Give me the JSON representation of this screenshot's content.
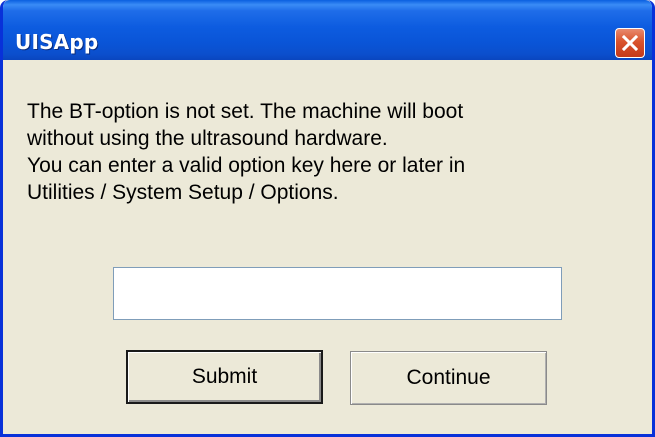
{
  "window": {
    "title": "UISApp",
    "close_icon": "close-icon"
  },
  "message": {
    "lines": [
      "The BT-option is not set. The machine will boot",
      "without using the ultrasound hardware.",
      "You can enter a valid option key here or later in",
      "Utilities / System Setup / Options."
    ]
  },
  "option_key": {
    "value": ""
  },
  "buttons": {
    "submit_label": "Submit",
    "continue_label": "Continue"
  },
  "colors": {
    "titlebar": "#0a55d8",
    "dialog_background": "#ece9d8",
    "close_button": "#d9532c"
  }
}
